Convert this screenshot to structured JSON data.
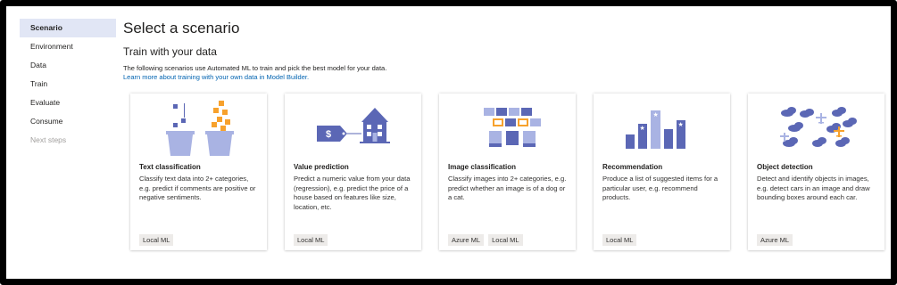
{
  "sidebar": {
    "items": [
      {
        "label": "Scenario"
      },
      {
        "label": "Environment"
      },
      {
        "label": "Data"
      },
      {
        "label": "Train"
      },
      {
        "label": "Evaluate"
      },
      {
        "label": "Consume"
      },
      {
        "label": "Next steps"
      }
    ]
  },
  "header": {
    "title": "Select a scenario",
    "subtitle": "Train with your data",
    "description": "The following scenarios use Automated ML to train and pick the best model for your data.",
    "learn_more": "Learn more about training with your own data in Model Builder."
  },
  "cards": [
    {
      "title": "Text classification",
      "description": "Classify text data into 2+ categories, e.g. predict if comments are positive or negative sentiments.",
      "tags": [
        "Local ML"
      ],
      "icon": "text-classification-icon"
    },
    {
      "title": "Value prediction",
      "description": "Predict a numeric value from your data (regression), e.g. predict the price of a house based on features like size, location, etc.",
      "tags": [
        "Local ML"
      ],
      "icon": "value-prediction-icon"
    },
    {
      "title": "Image classification",
      "description": "Classify images into 2+ categories, e.g. predict whether an image is of a dog or a cat.",
      "tags": [
        "Azure ML",
        "Local ML"
      ],
      "icon": "image-classification-icon"
    },
    {
      "title": "Recommendation",
      "description": "Produce a list of suggested items for a particular user, e.g. recommend products.",
      "tags": [
        "Local ML"
      ],
      "icon": "recommendation-icon"
    },
    {
      "title": "Object detection",
      "description": "Detect and identify objects in images, e.g. detect cars in an image and draw bounding boxes around each car.",
      "tags": [
        "Azure ML"
      ],
      "icon": "object-detection-icon"
    }
  ],
  "colors": {
    "accent_blue": "#5b67b5",
    "light_blue": "#a9b3e3",
    "orange": "#f7a12c",
    "link": "#0063b1",
    "active_nav": "#e1e6f5"
  }
}
